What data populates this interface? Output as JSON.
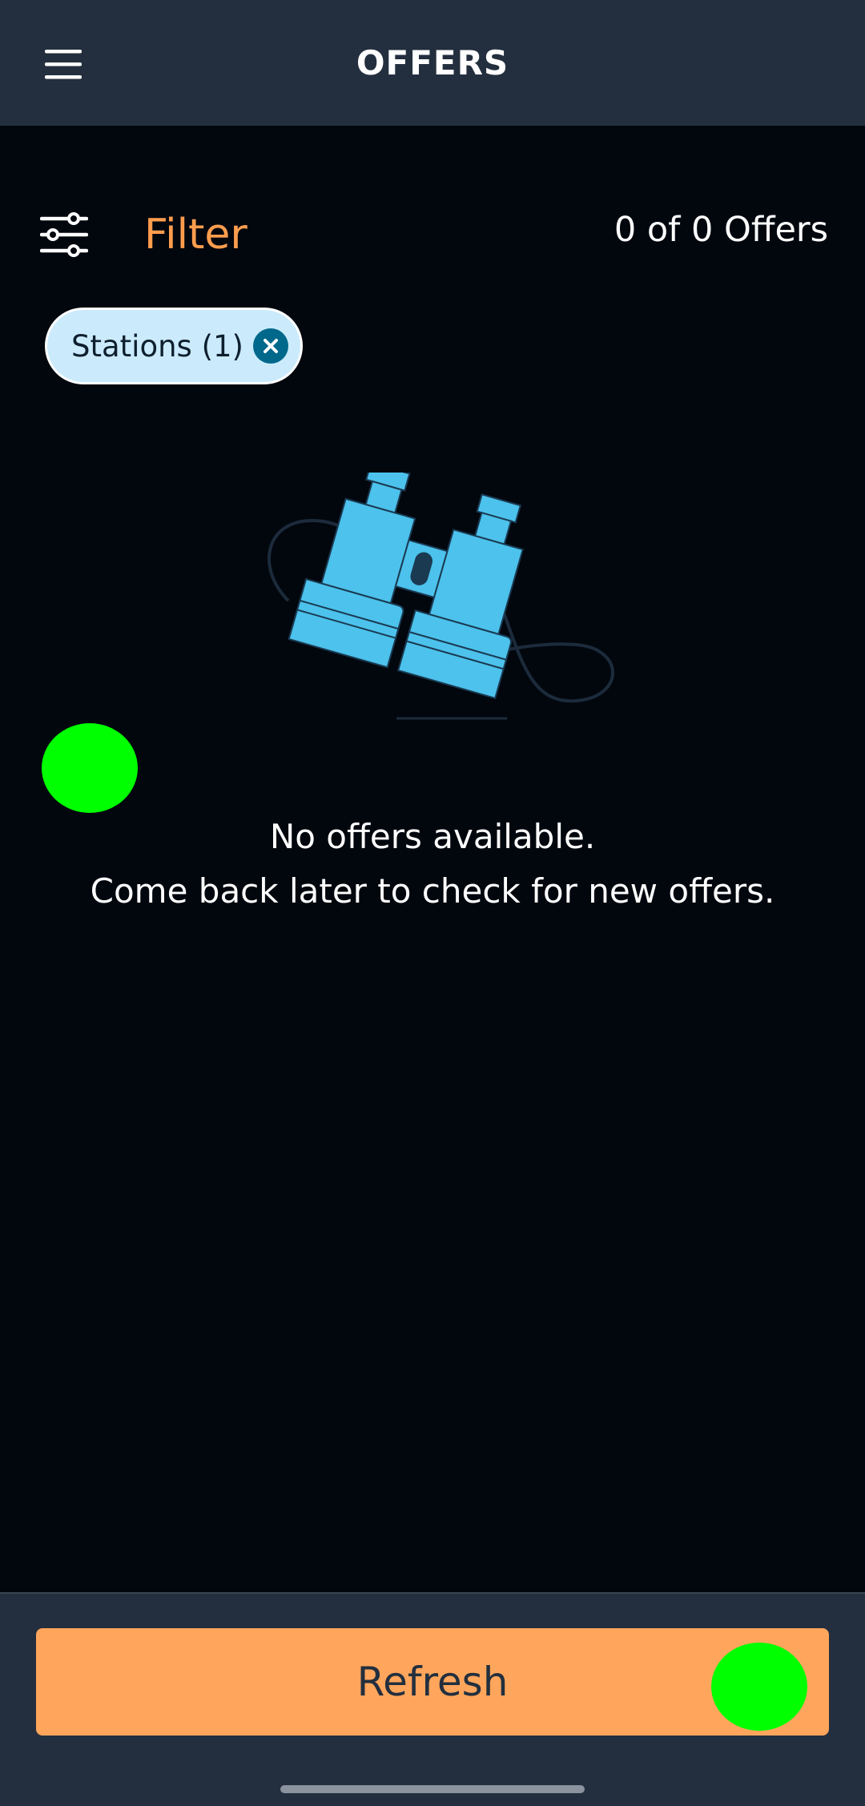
{
  "header": {
    "title": "OFFERS",
    "menu_icon": "hamburger-menu-icon"
  },
  "filter": {
    "label": "Filter",
    "icon": "sliders-icon",
    "count_text": "0 of 0 Offers"
  },
  "active_filters": [
    {
      "label": "Stations (1)",
      "icon": "close-circle-icon"
    }
  ],
  "empty_state": {
    "illustration": "binoculars-illustration",
    "title": "No offers available.",
    "subtitle": "Come back later to check for new offers."
  },
  "footer": {
    "refresh_label": "Refresh"
  },
  "colors": {
    "background": "#02070E",
    "bar": "#232F3E",
    "accent_orange": "#FF9D4D",
    "button_orange": "#FFA65C",
    "chip_bg": "#CBEBFC",
    "chip_icon": "#00688B",
    "illustration_blue": "#4CC2EC",
    "marker_green": "#00FF00"
  }
}
